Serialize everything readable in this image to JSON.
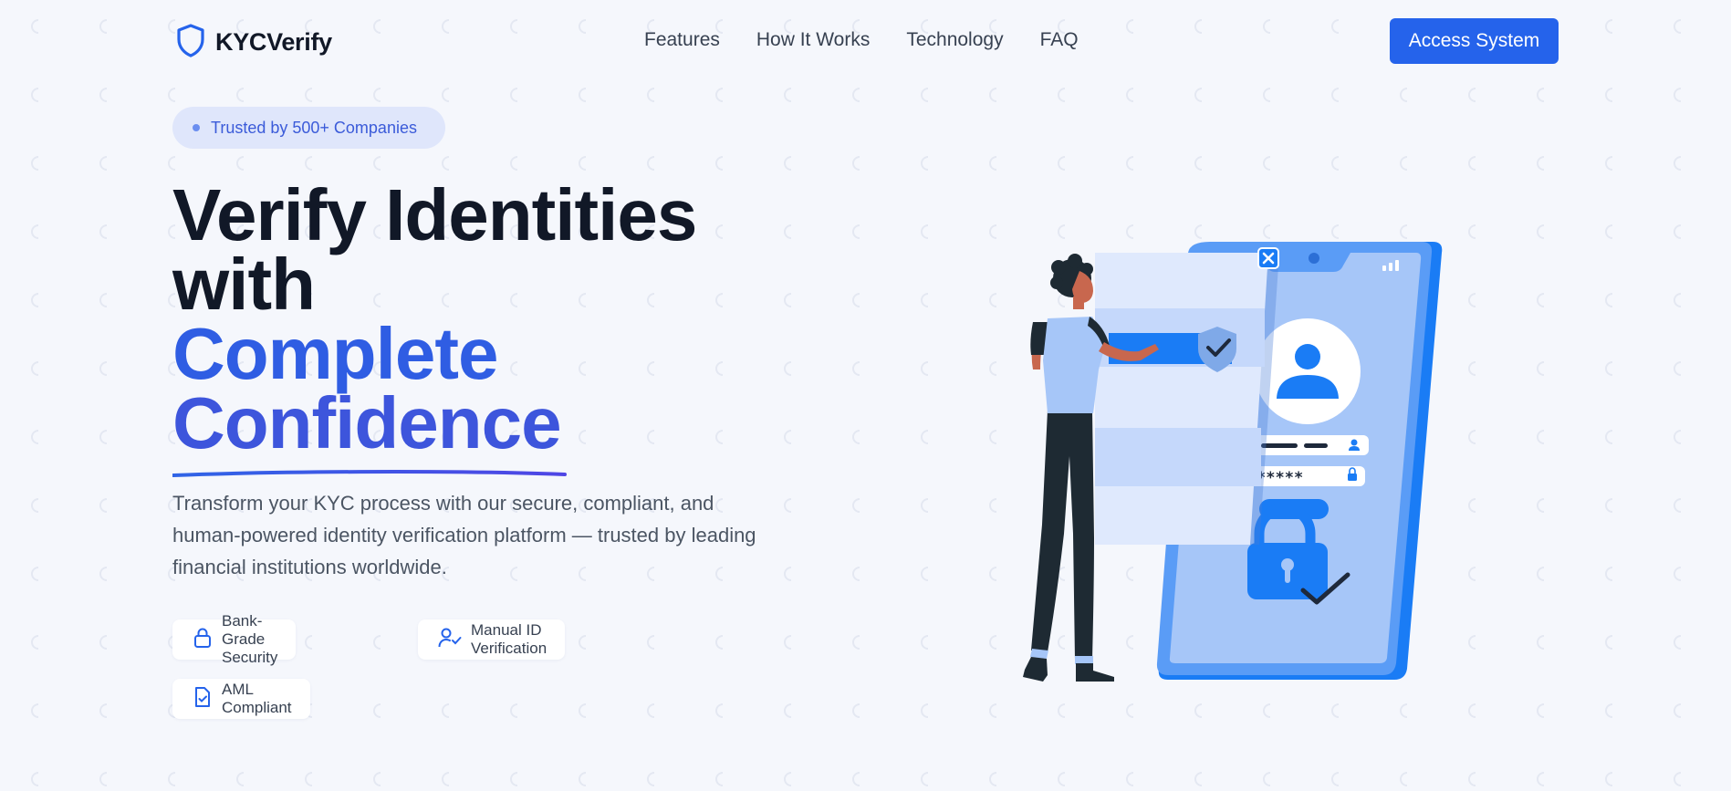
{
  "brand": {
    "name": "KYCVerify",
    "logo_icon": "shield-icon"
  },
  "nav": {
    "links": [
      "Features",
      "How It Works",
      "Technology",
      "FAQ"
    ],
    "cta": "Access System"
  },
  "hero": {
    "badge": "Trusted by 500+ Companies",
    "headline": {
      "line1": "Verify Identities",
      "line2": "with",
      "line3": "Complete",
      "line4": "Confidence"
    },
    "description": "Transform your KYC process with our secure, compliant, and human-powered identity verification platform — trusted by leading financial institutions worldwide.",
    "features": [
      {
        "icon": "lock-icon",
        "label": "Bank-Grade Security"
      },
      {
        "icon": "user-check-icon",
        "label": "Manual ID Verification"
      },
      {
        "icon": "file-check-icon",
        "label": "AML Compliant"
      }
    ]
  },
  "illustration": {
    "password_mask": "*****"
  },
  "colors": {
    "accent": "#2563eb",
    "heading": "#111827",
    "gradient_start": "#2f5de3",
    "gradient_end": "#4f46e5",
    "illustration_blue": "#1a7cf5"
  }
}
